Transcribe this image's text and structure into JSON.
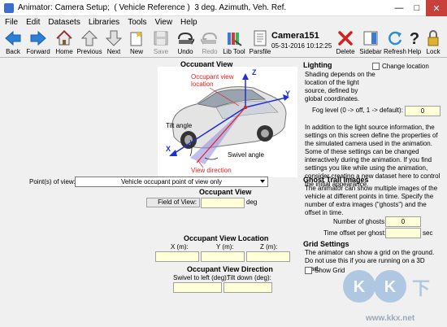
{
  "window": {
    "title": "Animator: Camera Setup;  ( Vehicle Reference )  3 deg. Azimuth, Veh. Ref.",
    "minimize": "—",
    "maximize": "□",
    "close": "✕"
  },
  "menu": [
    "File",
    "Edit",
    "Datasets",
    "Libraries",
    "Tools",
    "View",
    "Help"
  ],
  "toolbar": {
    "back": "Back",
    "forward": "Forward",
    "home": "Home",
    "previous": "Previous",
    "next": "Next",
    "new": "New",
    "save": "Save",
    "undo": "Undo",
    "redo": "Redo",
    "libtool": "Lib Tool",
    "parsfile": "Parsfile",
    "camera_name": "Camera151",
    "datetime": "05-31-2016 10:12:25",
    "delete": "Delete",
    "sidebar": "Sidebar",
    "refresh": "Refresh",
    "help": "Help",
    "lock": "Lock"
  },
  "left": {
    "occupant_view_title": "Occupant View",
    "illustration": {
      "occupant_location": "Occupant view\nlocation",
      "tilt_angle": "Tilt angle",
      "swivel_angle": "Swivel angle",
      "view_direction": "View direction",
      "axis_x": "X",
      "axis_y": "Y",
      "axis_z": "Z"
    },
    "point_of_view_label": "Point(s) of view:",
    "point_of_view_value": "Vehicle occupant point of view only",
    "occupant_view_heading": "Occupant View",
    "field_of_view_label": "Field of View:",
    "field_of_view_value": "",
    "field_of_view_unit": "deg",
    "location_heading": "Occupant View Location",
    "x_label": "X (m):",
    "y_label": "Y (m):",
    "z_label": "Z (m):",
    "x_value": "",
    "y_value": "",
    "z_value": "",
    "direction_heading": "Occupant View Direction",
    "swivel_label": "Swivel to left (deg):",
    "tilt_label": "Tilt down (deg):",
    "swivel_value": "",
    "tilt_value": ""
  },
  "right": {
    "lighting_title": "Lighting",
    "change_location": "Change location",
    "lighting_desc": "Shading depends on the location of the light source, defined by global coordinates.",
    "fog_label": "Fog level (0 -> off, 1 -> default):",
    "fog_value": "0",
    "info_text": "In addition to the light source information, the settings on this screen define the properties of the simulated camera used in the animation. Some of these settings can be changed interactively during the animation. If you find settings you like while using the animation, consider creating a new dataset here to control the initial appearance.",
    "ghost_title": "Ghost Trail Images",
    "ghost_desc": "The animator can show multiple images of the vehicle at different points in time. Specify the number of extra images (\"ghosts\") and the offset in time.",
    "num_ghosts_label": "Number of ghosts:",
    "num_ghosts_value": "0",
    "time_offset_label": "Time offset per ghost:",
    "time_offset_value": "",
    "time_offset_unit": "sec",
    "grid_title": "Grid Settings",
    "grid_desc": "The animator can show a grid on the ground. Do not use this if you are running on a 3D road.",
    "show_grid": "Show Grid"
  },
  "watermark": {
    "logo": "KK下载",
    "url": "www.kkx.net"
  },
  "colors": {
    "field_fill": "#ffffd8",
    "arrow_blue": "#2b7fd6",
    "delete_red": "#d32020",
    "axis_blue": "#1f2fd8",
    "annotation_red": "#e02020"
  }
}
